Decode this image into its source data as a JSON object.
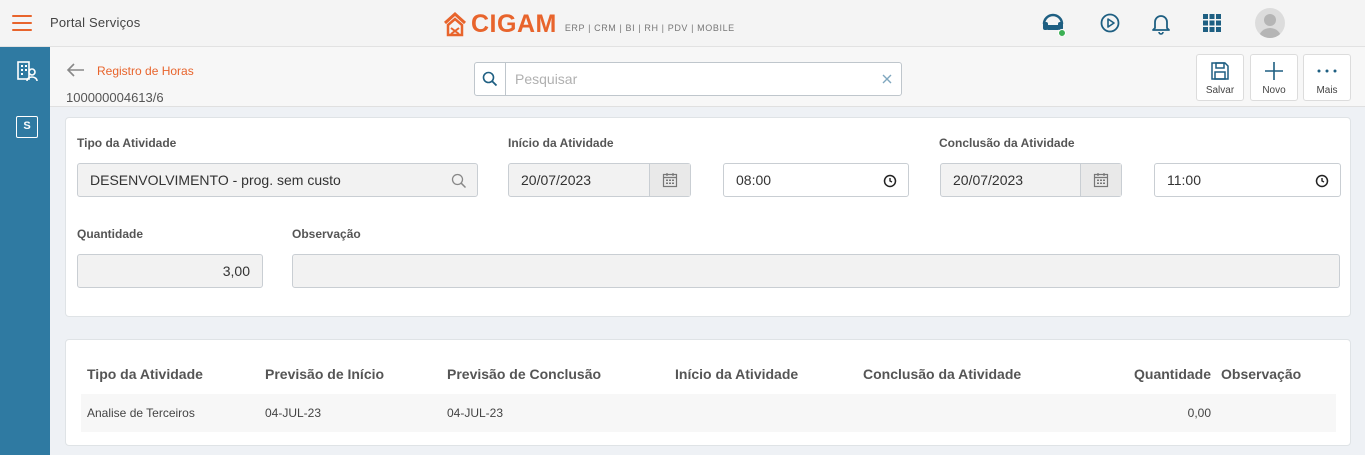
{
  "header": {
    "portal_title": "Portal Serviços",
    "logo_text": "CIGAM",
    "logo_sub": "ERP | CRM | BI | RH | PDV | MOBILE",
    "accent_color": "#e8642c",
    "icons": [
      "menu-icon",
      "support-icon",
      "play-icon",
      "bell-icon",
      "apps-grid-icon",
      "user-avatar"
    ]
  },
  "sidebar": {
    "color": "#2f7aa2",
    "items": [
      {
        "icon": "building-user-icon"
      },
      {
        "icon": "services-s-icon",
        "letter": "S"
      }
    ]
  },
  "page": {
    "breadcrumb": "Registro de Horas",
    "record_id": "100000004613/6",
    "search": {
      "placeholder": "Pesquisar",
      "value": ""
    },
    "actions": {
      "save": "Salvar",
      "new": "Novo",
      "more": "Mais"
    }
  },
  "form": {
    "tipo_label": "Tipo da Atividade",
    "tipo_value": "DESENVOLVIMENTO - prog. sem custo",
    "inicio_label": "Início da Atividade",
    "inicio_date": "20/07/2023",
    "inicio_time": "08:00",
    "conclusao_label": "Conclusão da Atividade",
    "conclusao_date": "20/07/2023",
    "conclusao_time": "11:00",
    "quantidade_label": "Quantidade",
    "quantidade_value": "3,00",
    "observacao_label": "Observação",
    "observacao_value": ""
  },
  "table": {
    "columns": [
      "Tipo da Atividade",
      "Previsão de Início",
      "Previsão de Conclusão",
      "Início da Atividade",
      "Conclusão da Atividade",
      "Quantidade",
      "Observação"
    ],
    "rows": [
      [
        "Analise de Terceiros",
        "04-JUL-23",
        "04-JUL-23",
        "",
        "",
        "0,00",
        ""
      ]
    ]
  }
}
